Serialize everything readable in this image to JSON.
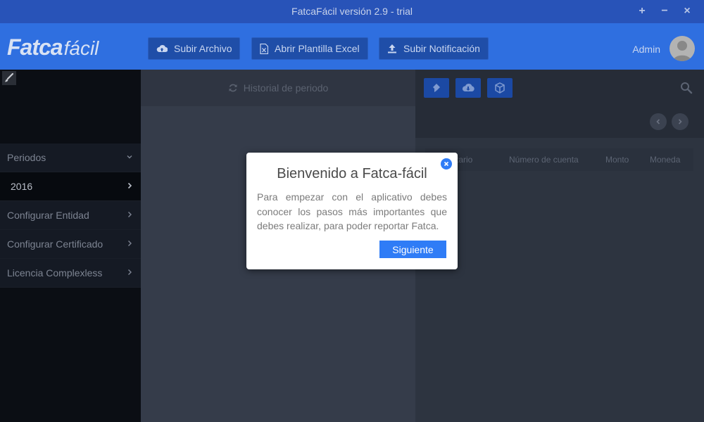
{
  "window": {
    "title": "FatcaFácil versión 2.9 - trial",
    "controls": [
      "+",
      "−",
      "×"
    ]
  },
  "header": {
    "logo_bold": "Fatca",
    "logo_thin": "fácil",
    "buttons": [
      {
        "label": "Subir Archivo",
        "icon": "cloud-upload-icon"
      },
      {
        "label": "Abrir Plantilla Excel",
        "icon": "excel-file-icon"
      },
      {
        "label": "Subir Notificación",
        "icon": "upload-icon"
      }
    ],
    "user": "Admin"
  },
  "sidebar": {
    "items": [
      {
        "label": "Periodos",
        "chevron": "down"
      },
      {
        "label": "2016",
        "chevron": "right"
      },
      {
        "label": "Configurar Entidad",
        "chevron": "right"
      },
      {
        "label": "Configurar Certificado",
        "chevron": "right"
      },
      {
        "label": "Licencia Complexless",
        "chevron": "right"
      }
    ]
  },
  "middle": {
    "header": "Historial de periodo"
  },
  "right": {
    "columns": [
      "tario",
      "Número de cuenta",
      "Monto",
      "Moneda"
    ]
  },
  "modal": {
    "title": "Bienvenido a Fatca-fácil",
    "text": "Para empezar con el aplicativo debes conocer los pasos más importantes que debes realizar, para poder reportar Fatca.",
    "button": "Siguiente"
  },
  "colors": {
    "accent": "#2f7cf6",
    "header": "#2f6fe0",
    "titlebar": "#2853b8"
  }
}
